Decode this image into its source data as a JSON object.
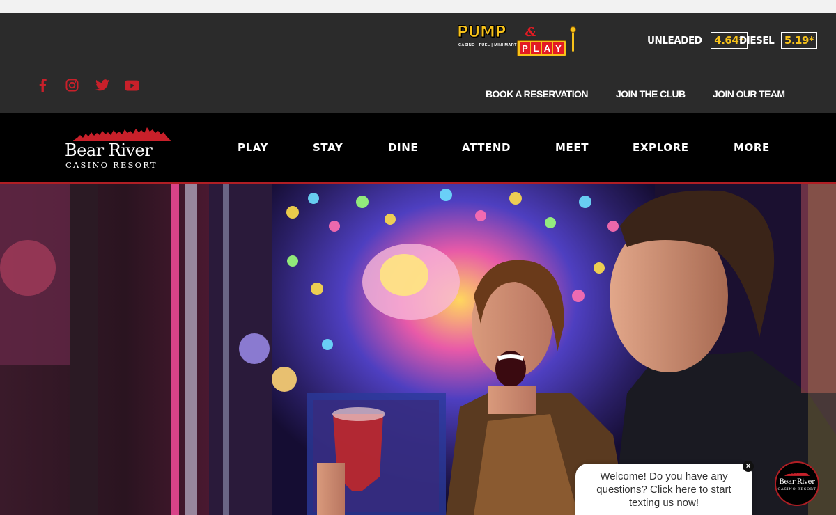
{
  "pump_play": {
    "pump": "PUMP",
    "amp": "&",
    "sub": "CASINO | FUEL | MINI MART",
    "play_letters": [
      "P",
      "L",
      "A",
      "Y"
    ]
  },
  "fuel": {
    "unleaded_label": "UNLEADED",
    "unleaded_price": "4.64*",
    "diesel_label": "DIESEL",
    "diesel_price": "5.19*"
  },
  "social": [
    "facebook-icon",
    "instagram-icon",
    "twitter-icon",
    "youtube-icon"
  ],
  "utility_links": {
    "book": "BOOK A RESERVATION",
    "club": "JOIN THE CLUB",
    "team": "JOIN OUR TEAM"
  },
  "brand": {
    "name": "Bear River",
    "sub": "CASINO RESORT"
  },
  "nav": {
    "play": "PLAY",
    "stay": "STAY",
    "dine": "DINE",
    "attend": "ATTEND",
    "meet": "MEET",
    "explore": "EXPLORE",
    "more": "MORE"
  },
  "chat": {
    "message": "Welcome! Do you have any questions? Click here to start texting us now!",
    "close": "×"
  },
  "colors": {
    "accent_red": "#b01e24",
    "price_yellow": "#f7c21a",
    "bar_dark": "#2b2b2b",
    "nav_black": "#000000"
  }
}
